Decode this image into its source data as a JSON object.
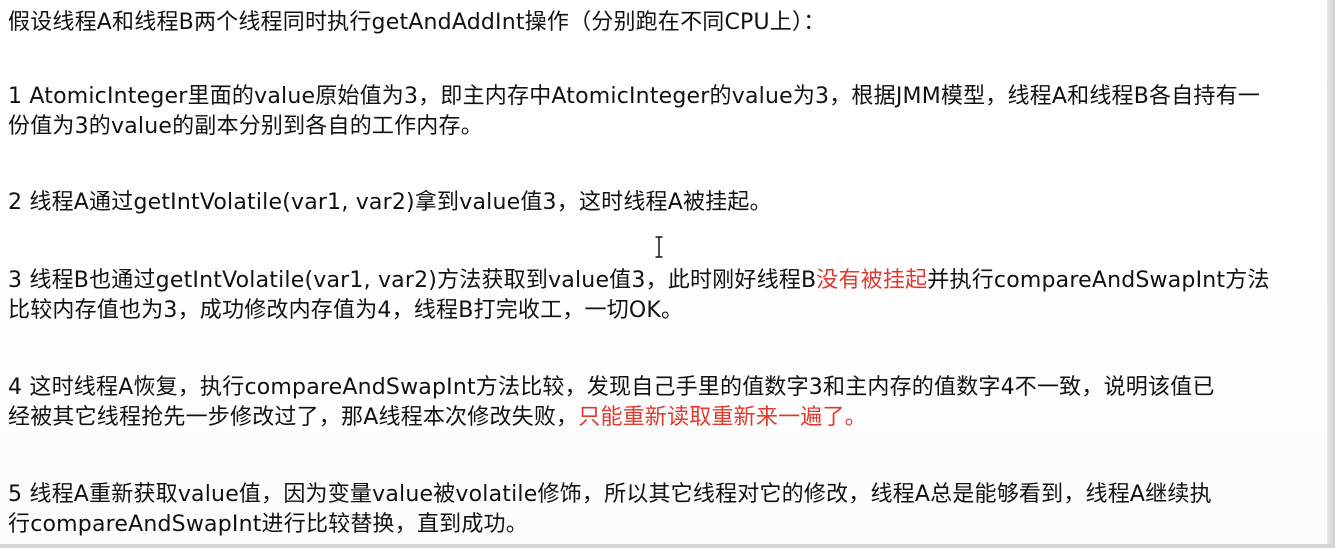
{
  "title": "假设线程A和线程B两个线程同时执行getAndAddInt操作（分别跑在不同CPU上）：",
  "steps": [
    {
      "line1": "1  AtomicInteger里面的value原始值为3，即主内存中AtomicInteger的value为3，根据JMM模型，线程A和线程B各自持有一",
      "line2": "份值为3的value的副本分别到各自的工作内存。"
    },
    {
      "line1": "2  线程A通过getIntVolatile(var1, var2)拿到value值3，这时线程A被挂起。"
    },
    {
      "line1_before": "3  线程B也通过getIntVolatile(var1, var2)方法获取到value值3，此时刚好线程B",
      "line1_highlight": "没有被挂起",
      "line1_after": "并执行compareAndSwapInt方法",
      "line2": "比较内存值也为3，成功修改内存值为4，线程B打完收工，一切OK。"
    },
    {
      "line1": "4  这时线程A恢复，执行compareAndSwapInt方法比较，发现自己手里的值数字3和主内存的值数字4不一致，说明该值已",
      "line2_before": "经被其它线程抢先一步修改过了，那A线程本次修改失败，",
      "line2_highlight": "只能重新读取重新来一遍了。"
    },
    {
      "line1": "5  线程A重新获取value值，因为变量value被volatile修饰，所以其它线程对它的修改，线程A总是能够看到，线程A继续执",
      "line2": "行compareAndSwapInt进行比较替换，直到成功。"
    }
  ],
  "colors": {
    "text": "#111111",
    "highlight": "#e03a2f",
    "background": "#ffffff"
  },
  "icons": {
    "cursor": "text-cursor-icon"
  }
}
